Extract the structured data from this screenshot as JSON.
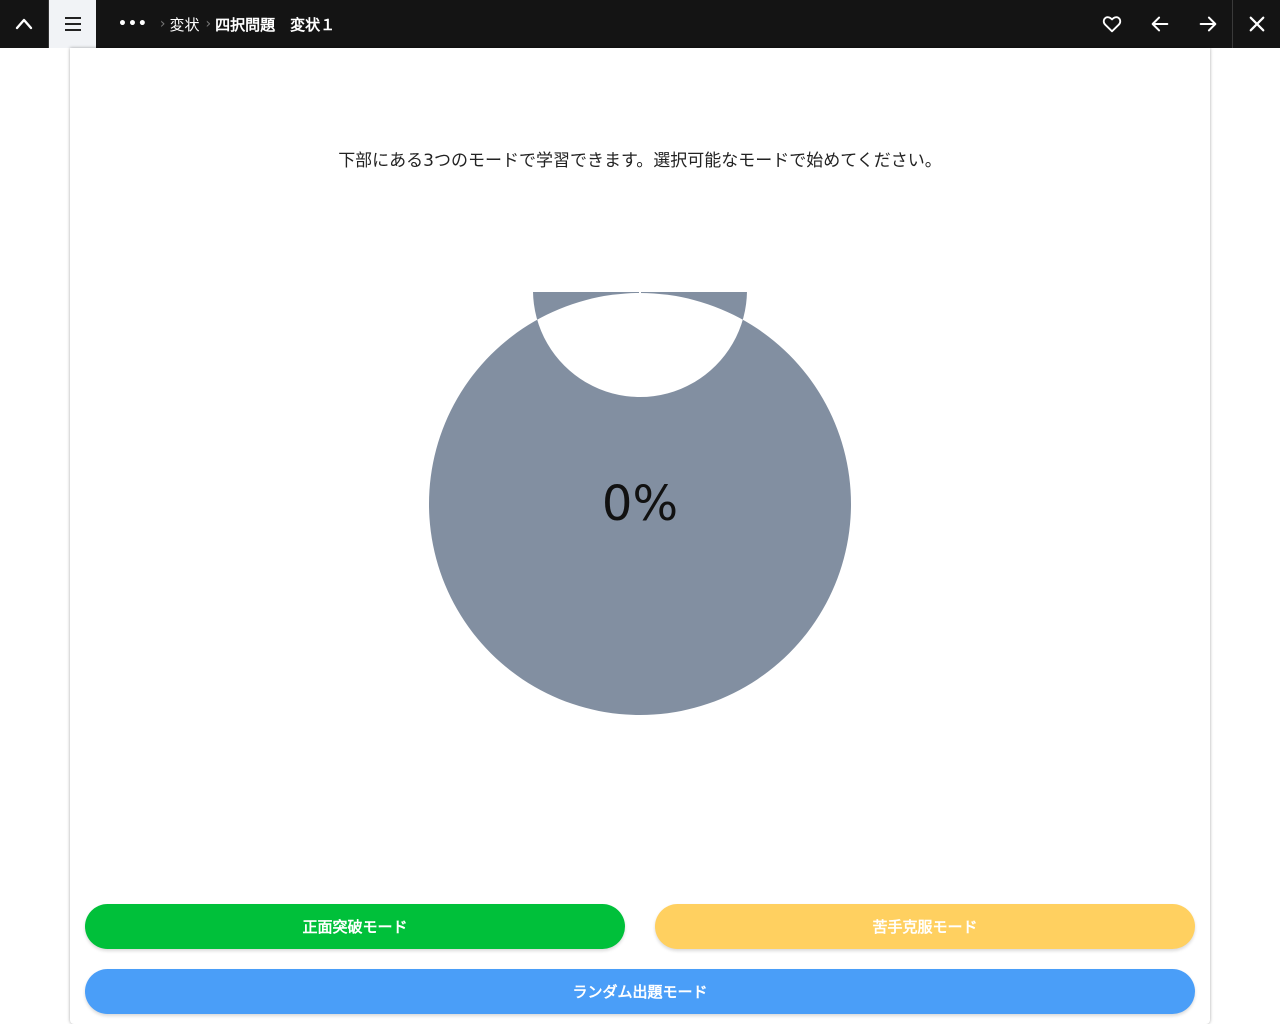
{
  "topbar": {
    "breadcrumbs": [
      "変状",
      "四択問題　変状１"
    ],
    "icons": {
      "collapse": "chevron-up-icon",
      "menu": "hamburger-menu-icon",
      "more": "ellipsis-icon",
      "favorite": "heart-icon",
      "prev": "arrow-left-icon",
      "next": "arrow-right-icon",
      "close": "close-icon"
    }
  },
  "main": {
    "intro_text": "下部にある3つのモードで学習できます。選択可能なモードで始めてください。",
    "progress_label": "0%"
  },
  "chart_data": {
    "type": "pie",
    "donut": true,
    "values": [
      0,
      100
    ],
    "colors": [
      "#00c03a",
      "#828fa1"
    ],
    "center_label": "0%"
  },
  "modes": {
    "front_label": "正面突破モード",
    "weak_label": "苦手克服モード",
    "random_label": "ランダム出題モード"
  },
  "colors": {
    "topbar": "#141414",
    "front": "#00c03a",
    "weak": "#ffd060",
    "random": "#4a9ef8",
    "chart_gray": "#828fa1"
  }
}
